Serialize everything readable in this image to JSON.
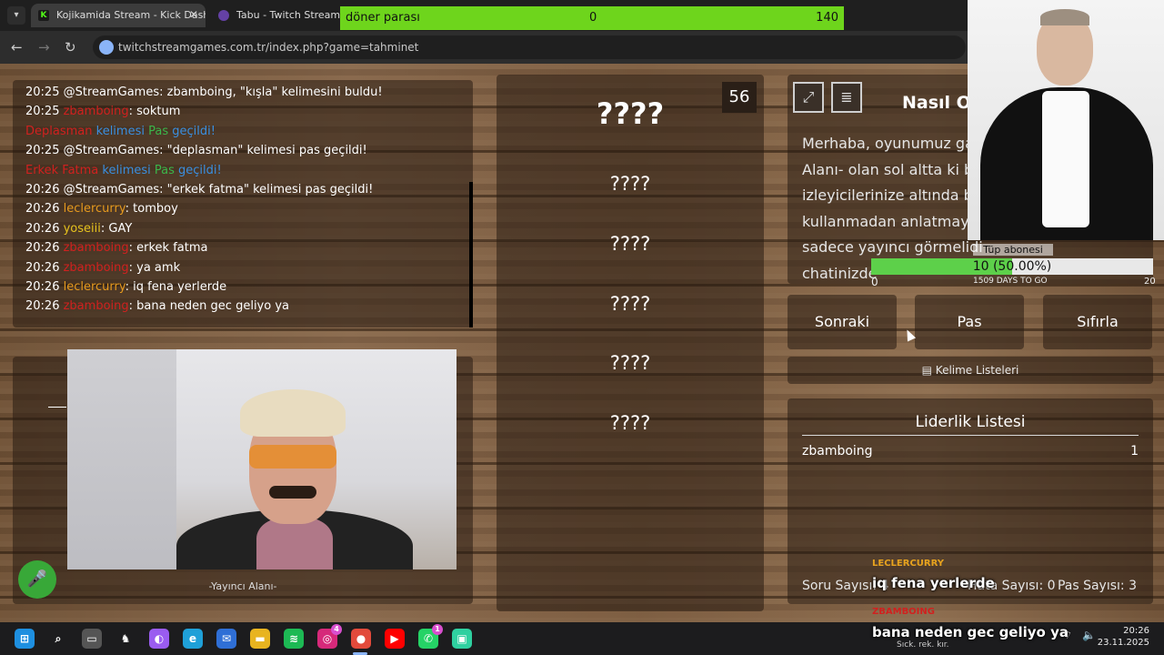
{
  "browser": {
    "tabs": [
      {
        "title": "Kojikamida Stream - Kick Dashb",
        "icon": "kick-icon"
      },
      {
        "title": "Tabu - Twitch Stream Gam",
        "icon": "twitch-icon"
      }
    ],
    "url": "twitchstreamgames.com.tr/index.php?game=tahminet"
  },
  "doner": {
    "label": "döner parası",
    "current": "0",
    "max": "140",
    "progress": 0,
    "color": "#6ed51c"
  },
  "chat": [
    {
      "time": "20:25",
      "user": "@StreamGames",
      "user_color": "white",
      "sep": ": ",
      "msg": "zbamboing, \"kışla\" kelimesini buldu!"
    },
    {
      "time": "20:25",
      "user": "zbamboing",
      "user_color": "red",
      "sep": ": ",
      "msg": "soktum"
    },
    {
      "time": "",
      "user": "Deplasman",
      "user_color": "red",
      "sep": " ",
      "msg_parts": [
        {
          "t": "kelimesi ",
          "c": "blue"
        },
        {
          "t": "Pas",
          "c": "green"
        },
        {
          "t": " geçildi!",
          "c": "blue"
        }
      ]
    },
    {
      "time": "20:25",
      "user": "@StreamGames",
      "user_color": "white",
      "sep": ": ",
      "msg": "\"deplasman\" kelimesi pas geçildi!"
    },
    {
      "time": "",
      "user": "Erkek Fatma",
      "user_color": "red",
      "sep": " ",
      "msg_parts": [
        {
          "t": "kelimesi ",
          "c": "blue"
        },
        {
          "t": "Pas",
          "c": "green"
        },
        {
          "t": " geçildi!",
          "c": "blue"
        }
      ]
    },
    {
      "time": "20:26",
      "user": "@StreamGames",
      "user_color": "white",
      "sep": ": ",
      "msg": "\"erkek fatma\" kelimesi pas geçildi!"
    },
    {
      "time": "20:26",
      "user": "leclercurry",
      "user_color": "orange",
      "sep": ": ",
      "msg": "tomboy"
    },
    {
      "time": "20:26",
      "user": "yoseiii",
      "user_color": "yellow",
      "sep": ": ",
      "msg": "GAY"
    },
    {
      "time": "20:26",
      "user": "zbamboing",
      "user_color": "red",
      "sep": ": ",
      "msg": "erkek fatma"
    },
    {
      "time": "20:26",
      "user": "zbamboing",
      "user_color": "red",
      "sep": ": ",
      "msg": "ya amk"
    },
    {
      "time": "20:26",
      "user": "leclercurry",
      "user_color": "orange",
      "sep": ": ",
      "msg": "iq fena yerlerde"
    },
    {
      "time": "20:26",
      "user": "zbamboing",
      "user_color": "red",
      "sep": ": ",
      "msg": "bana neden gec geliyo ya"
    }
  ],
  "camera": {
    "label": "-Yayıncı Alanı-"
  },
  "words": {
    "counter": "56",
    "items": [
      "????",
      "????",
      "????",
      "????",
      "????",
      "????"
    ]
  },
  "howto": {
    "title": "Nasıl Oy",
    "lines": [
      "Merhaba, oyunumuz ga",
      "Alanı- olan sol altta ki bö",
      "izleyicilerinize altında bu",
      "kullanmadan anlatmaya",
      "sadece yayıncı görmelidi",
      "chatinizde"
    ]
  },
  "buttons": {
    "next": "Sonraki",
    "pass": "Pas",
    "reset": "Sıfırla"
  },
  "lists_button": "Kelime Listeleri",
  "leaderboard": {
    "title": "Liderlik Listesi",
    "rows": [
      {
        "name": "zbamboing",
        "score": "1"
      }
    ],
    "question_count_label": "Soru Sayısı: 4",
    "error_count_label": "Hata Sayısı: 0",
    "pass_count_label": "Pas Sayısı: 3"
  },
  "sub_goal": {
    "title": "Tüp abonesi",
    "text": "10 (50.00%)",
    "fraction": 0.5,
    "min": "0",
    "days": "1509 DAYS TO GO",
    "max": "20"
  },
  "overlay_chat": [
    {
      "user": "LECLERCURRY",
      "color": "#e8a31e",
      "msg": "iq fena yerlerde"
    },
    {
      "user": "ZBAMBOING",
      "color": "#d0211f",
      "msg": "bana neden gec geliyo ya"
    }
  ],
  "taskbar": {
    "weather": "Sıck. rek. kır.",
    "time": "20:26",
    "date": "23.11.2025",
    "apps": [
      "windows-start-icon",
      "search-icon",
      "task-view-icon",
      "wolf-app-icon",
      "copilot-icon",
      "edge-icon",
      "mail-icon",
      "file-explorer-icon",
      "spotify-icon",
      "instagram-icon",
      "chrome-icon",
      "youtube-icon",
      "whatsapp-icon",
      "game-app-icon"
    ],
    "instagram_badge": "4",
    "whatsapp_badge": "1"
  }
}
